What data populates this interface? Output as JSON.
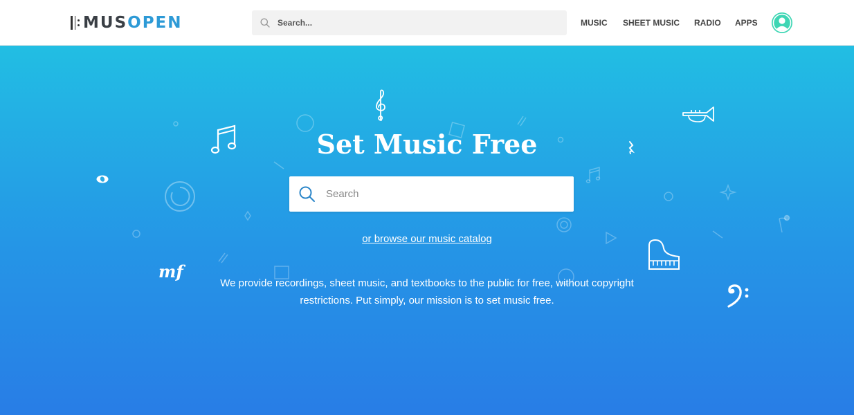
{
  "header": {
    "logo": {
      "part1": "MUS",
      "part2": "OPEN"
    },
    "search": {
      "placeholder": "Search..."
    },
    "nav": [
      {
        "label": "MUSIC"
      },
      {
        "label": "SHEET MUSIC"
      },
      {
        "label": "RADIO"
      },
      {
        "label": "APPS"
      }
    ]
  },
  "hero": {
    "title": "Set Music Free",
    "search": {
      "placeholder": "Search"
    },
    "browse_link": "or browse our music catalog",
    "mission_line1": "We provide recordings, sheet music, and textbooks to the public for free, without copyright",
    "mission_line2": "restrictions. Put simply, our mission is to set music free.",
    "mf_text": "mf"
  },
  "colors": {
    "brand_blue": "#2d9ad6",
    "hero_top": "#22bee3",
    "hero_bottom": "#287de6",
    "avatar": "#3ed6b4"
  }
}
